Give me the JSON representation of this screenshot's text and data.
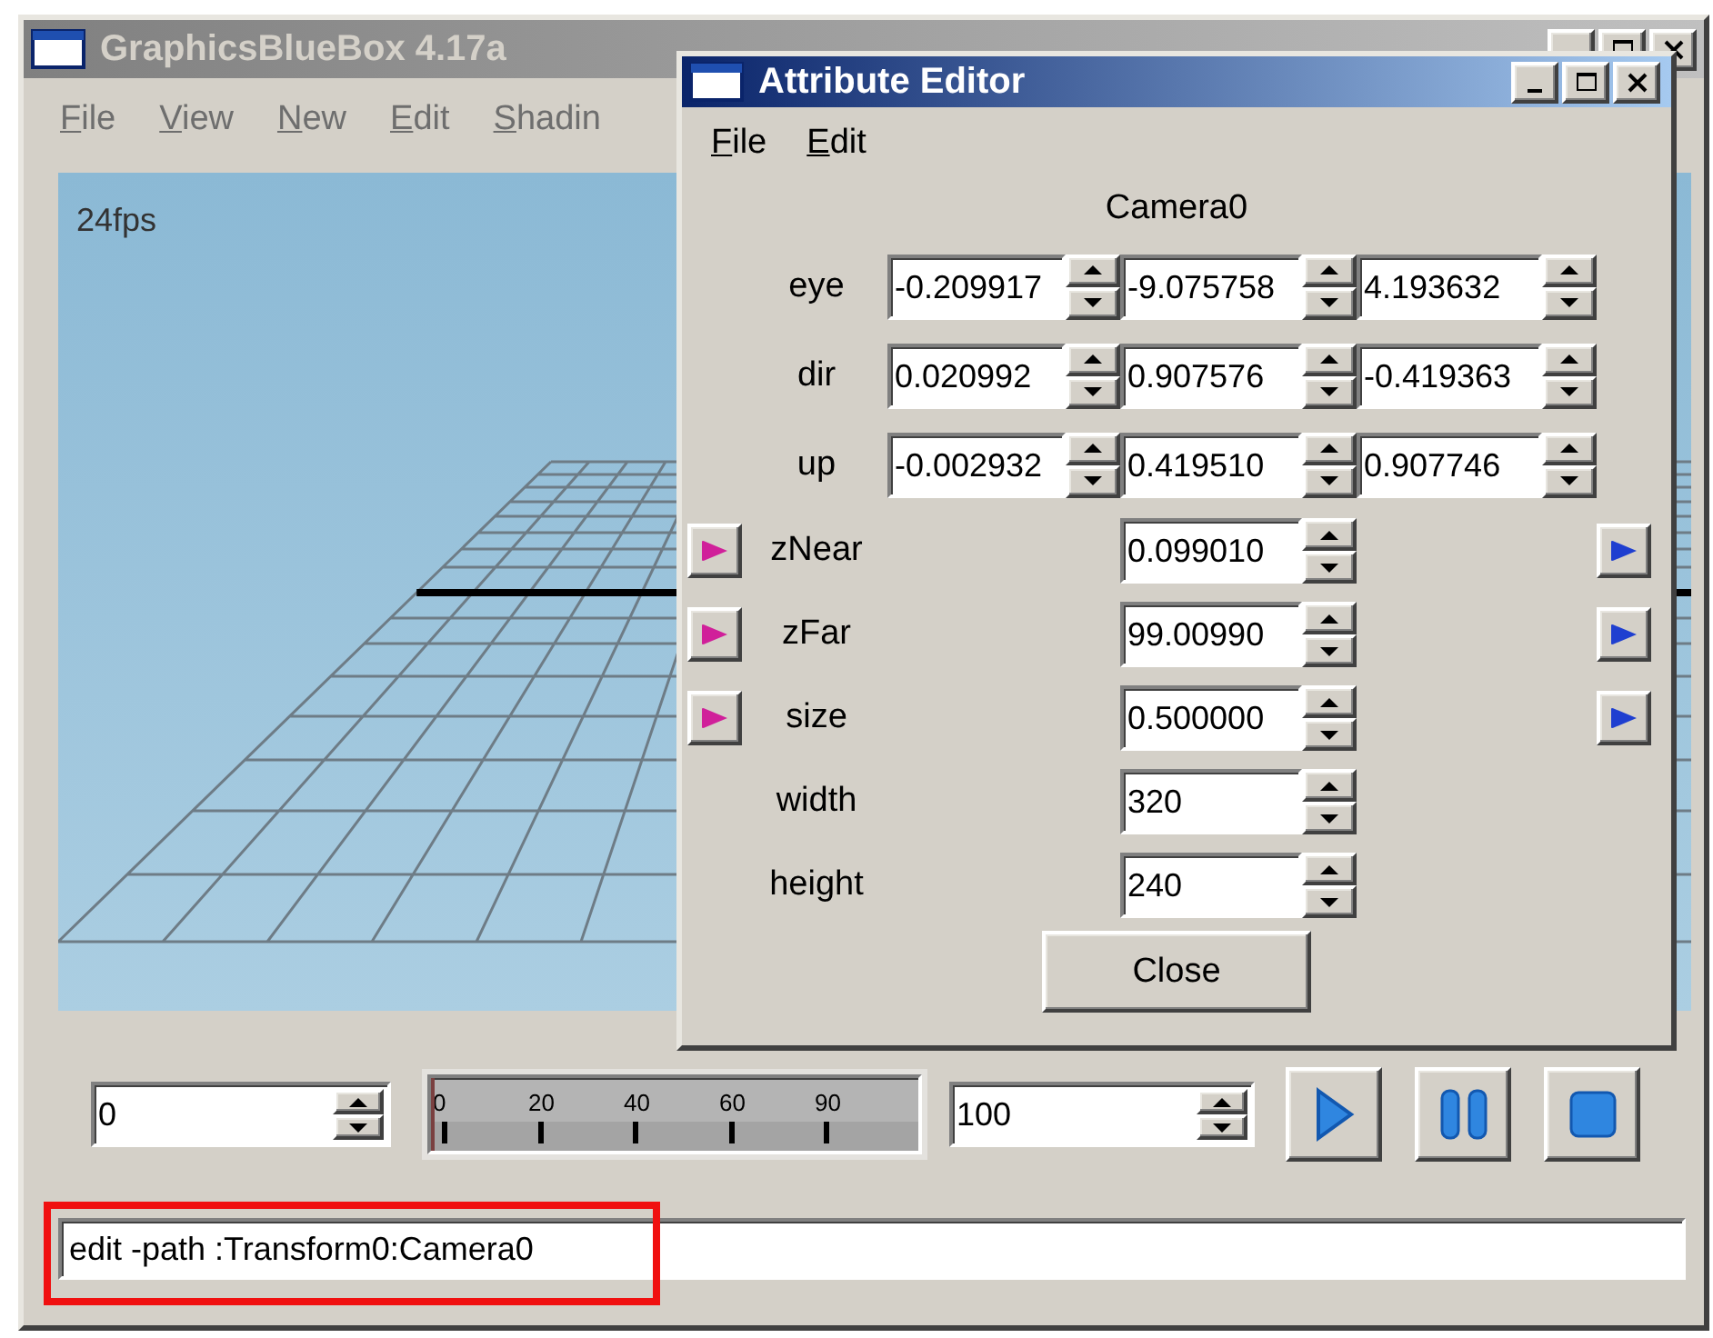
{
  "main_window": {
    "title": "GraphicsBlueBox 4.17a",
    "active": false,
    "menu": [
      "File",
      "View",
      "New",
      "Edit",
      "Shadin"
    ],
    "viewport": {
      "fps": "24fps"
    },
    "timeline": {
      "start": "0",
      "ticks": [
        "0",
        "20",
        "40",
        "60",
        "90"
      ],
      "level": 0,
      "end": "100"
    },
    "playback_buttons": [
      {
        "kind": "play"
      },
      {
        "kind": "pause"
      },
      {
        "kind": "stop"
      }
    ],
    "command": {
      "value": "edit -path :Transform0:Camera0",
      "highlighted": true
    }
  },
  "attribute_editor": {
    "title": "Attribute Editor",
    "active": true,
    "menu": [
      "File",
      "Edit"
    ],
    "node": "Camera0",
    "attributes": [
      {
        "kind": "vector",
        "label": "eye",
        "values": [
          "-0.209917",
          "-9.075758",
          "4.193632"
        ]
      },
      {
        "kind": "vector",
        "label": "dir",
        "values": [
          "0.020992",
          "0.907576",
          "-0.419363"
        ]
      },
      {
        "kind": "vector",
        "label": "up",
        "values": [
          "-0.002932",
          "0.419510",
          "0.907746"
        ]
      },
      {
        "kind": "animatable",
        "label": "zNear",
        "values": [
          "0.099010"
        ]
      },
      {
        "kind": "animatable",
        "label": "zFar",
        "values": [
          "99.00990"
        ]
      },
      {
        "kind": "animatable",
        "label": "size",
        "values": [
          "0.500000"
        ]
      },
      {
        "kind": "plain",
        "label": "width",
        "values": [
          "320"
        ]
      },
      {
        "kind": "plain",
        "label": "height",
        "values": [
          "240"
        ]
      }
    ],
    "close_button": "Close"
  }
}
